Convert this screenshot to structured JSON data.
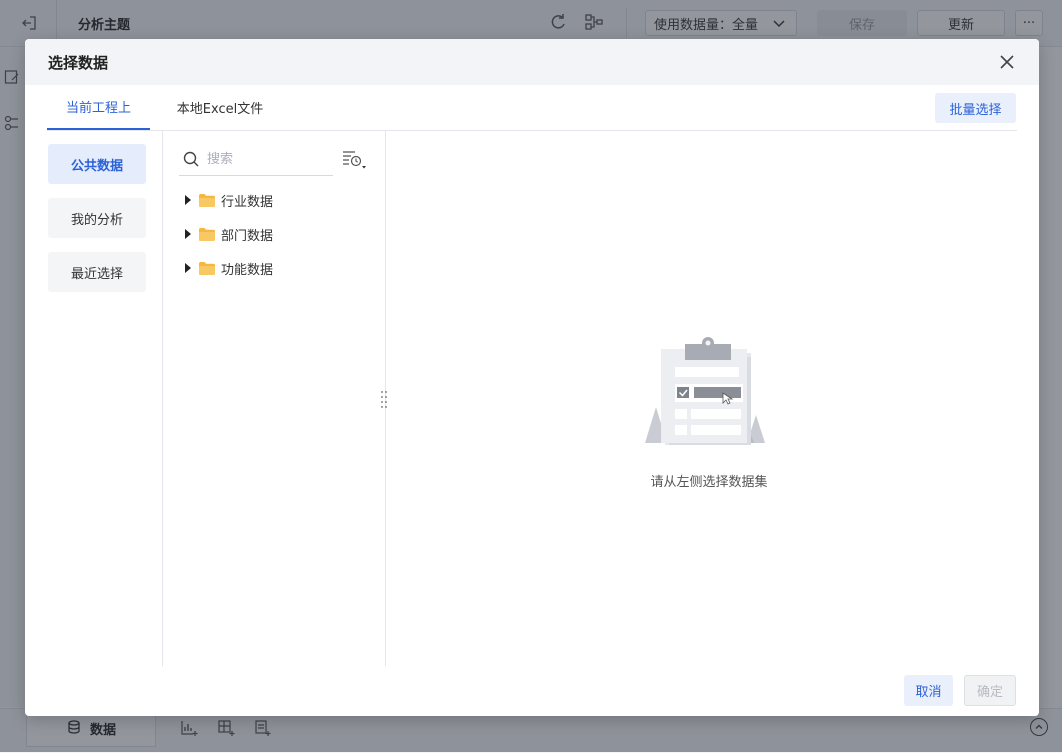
{
  "app": {
    "title": "分析主题",
    "dataset_label": "使用数据量：全量",
    "save_label": "保存",
    "update_label": "更新",
    "more_label": "···",
    "bottom_tab_label": "数据"
  },
  "dialog": {
    "title": "选择数据",
    "tabs": [
      {
        "label": "当前工程上",
        "active": true
      },
      {
        "label": "本地Excel文件",
        "active": false
      }
    ],
    "batch_select_label": "批量选择",
    "categories": [
      {
        "label": "公共数据",
        "active": true
      },
      {
        "label": "我的分析",
        "active": false
      },
      {
        "label": "最近选择",
        "active": false
      }
    ],
    "search": {
      "placeholder": "搜索",
      "value": ""
    },
    "tree": [
      {
        "label": "行业数据",
        "icon": "folder-icon"
      },
      {
        "label": "部门数据",
        "icon": "folder-icon"
      },
      {
        "label": "功能数据",
        "icon": "folder-icon"
      }
    ],
    "empty_text": "请从左侧选择数据集",
    "cancel_label": "取消",
    "ok_label": "确定"
  },
  "colors": {
    "accent": "#2c62d8",
    "folder": "#f5b73f",
    "mask": "rgba(40,46,60,0.5)"
  }
}
